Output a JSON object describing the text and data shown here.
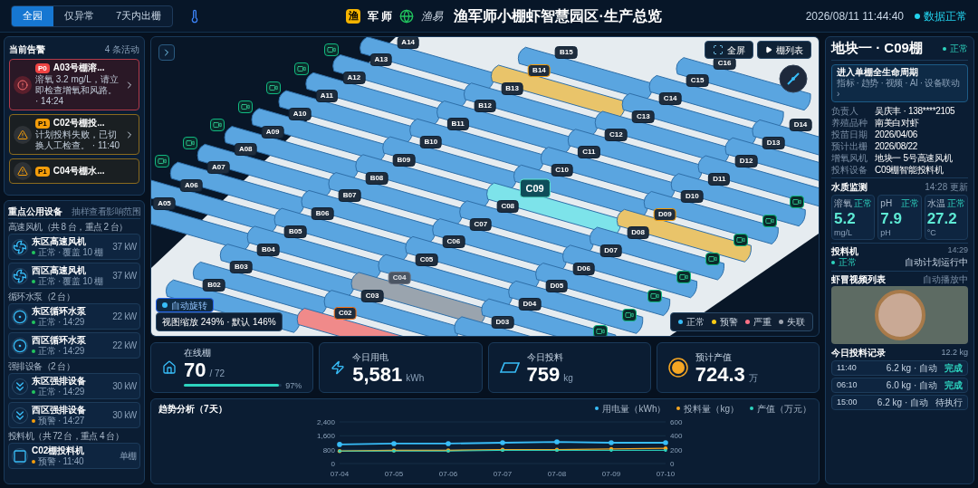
{
  "header": {
    "tabs": [
      {
        "label": "全园",
        "selected": true
      },
      {
        "label": "仅异常",
        "selected": false
      },
      {
        "label": "7天内出栅",
        "selected": false
      }
    ],
    "brand": {
      "mark": "渔",
      "name": "军 师",
      "partner": "渔易"
    },
    "title": "渔军师小棚虾智慧园区·生产总览",
    "datetime": "2026/08/11 11:44:40",
    "data_status": {
      "label": "数据正常",
      "ok": true
    }
  },
  "alerts": {
    "title": "当前告警",
    "count": "4 条活动",
    "items": [
      {
        "level": "P0",
        "kind": "critical",
        "title": "A03号棚溶...",
        "message": "溶氧 3.2 mg/L，请立即检查增氧和风路。 · 14:24"
      },
      {
        "level": "P1",
        "kind": "warning",
        "title": "C02号棚投...",
        "message": "计划投料失败，已切换人工检查。 · 11:40"
      },
      {
        "level": "P1",
        "kind": "warning",
        "title": "C04号棚水..."
      }
    ]
  },
  "equipment": {
    "title": "重点公用设备",
    "hint": "抽样查看影响范围",
    "groups": [
      {
        "label": "高速风机（共 8 台，重点 2 台）",
        "items": [
          {
            "kind": "fan",
            "name": "东区高速风机",
            "alert": false,
            "note": "正常 · 覆盖 10 棚",
            "value": "37 kW"
          },
          {
            "kind": "fan",
            "name": "西区高速风机",
            "alert": false,
            "note": "正常 · 覆盖 10 棚",
            "value": "37 kW"
          }
        ]
      },
      {
        "label": "循环水泵（2 台）",
        "items": [
          {
            "kind": "pump",
            "name": "东区循环水泵",
            "alert": false,
            "note": "正常 · 14:29",
            "value": "22 kW"
          },
          {
            "kind": "pump",
            "name": "西区循环水泵",
            "alert": false,
            "note": "正常 · 14:29",
            "value": "22 kW"
          }
        ]
      },
      {
        "label": "强排设备（2 台）",
        "items": [
          {
            "kind": "exhaust",
            "name": "东区强排设备",
            "alert": false,
            "note": "正常 · 14:29",
            "value": "30 kW"
          },
          {
            "kind": "exhaust",
            "name": "西区强排设备",
            "alert": true,
            "note": "预警 · 14:27",
            "value": "30 kW"
          }
        ]
      },
      {
        "label": "投料机（共 72 台，重点 4 台）",
        "items": [
          {
            "kind": "feeder",
            "name": "C02棚投料机",
            "alert": true,
            "note": "预警 · 11:40",
            "value": "单棚"
          }
        ]
      }
    ]
  },
  "map": {
    "buttons": [
      {
        "kind": "fullscreen",
        "label": "全屏"
      },
      {
        "kind": "list",
        "label": "棚列表"
      }
    ],
    "lanes": [
      {
        "houses": [
          {
            "label": "A14",
            "kind": "normal",
            "selected": false
          },
          {
            "label": "A13",
            "kind": "normal",
            "selected": false
          },
          {
            "label": "A12",
            "kind": "normal",
            "selected": false
          },
          {
            "label": "A11",
            "kind": "normal",
            "selected": false
          },
          {
            "label": "A10",
            "kind": "normal",
            "selected": false
          },
          {
            "label": "A09",
            "kind": "normal",
            "selected": false
          },
          {
            "label": "A08",
            "kind": "normal",
            "selected": false
          },
          {
            "label": "A07",
            "kind": "normal",
            "selected": false
          },
          {
            "label": "A06",
            "kind": "normal",
            "selected": false
          },
          {
            "label": "A05",
            "kind": "normal",
            "selected": false
          }
        ]
      },
      {
        "houses": [
          {
            "label": "B15",
            "kind": "normal",
            "selected": false
          },
          {
            "label": "B14",
            "kind": "warning",
            "selected": false
          },
          {
            "label": "B13",
            "kind": "normal",
            "selected": false
          },
          {
            "label": "B12",
            "kind": "normal",
            "selected": false
          },
          {
            "label": "B11",
            "kind": "normal",
            "selected": false
          },
          {
            "label": "B10",
            "kind": "normal",
            "selected": false
          },
          {
            "label": "B09",
            "kind": "normal",
            "selected": false
          },
          {
            "label": "B08",
            "kind": "normal",
            "selected": false
          },
          {
            "label": "B07",
            "kind": "normal",
            "selected": false
          },
          {
            "label": "B06",
            "kind": "normal",
            "selected": false
          },
          {
            "label": "B05",
            "kind": "normal",
            "selected": false
          },
          {
            "label": "B04",
            "kind": "normal",
            "selected": false
          },
          {
            "label": "B03",
            "kind": "normal",
            "selected": false
          },
          {
            "label": "B02",
            "kind": "normal",
            "selected": false
          }
        ]
      },
      {
        "houses": [
          {
            "label": "C16",
            "kind": "normal",
            "selected": false
          },
          {
            "label": "C15",
            "kind": "normal",
            "selected": false
          },
          {
            "label": "C14",
            "kind": "normal",
            "selected": false
          },
          {
            "label": "C13",
            "kind": "normal",
            "selected": false
          },
          {
            "label": "C12",
            "kind": "normal",
            "selected": false
          },
          {
            "label": "C11",
            "kind": "normal",
            "selected": false
          },
          {
            "label": "C10",
            "kind": "normal",
            "selected": false
          },
          {
            "label": "C09",
            "kind": "normal",
            "selected": true
          },
          {
            "label": "C08",
            "kind": "normal",
            "selected": false
          },
          {
            "label": "C07",
            "kind": "normal",
            "selected": false
          },
          {
            "label": "C06",
            "kind": "normal",
            "selected": false
          },
          {
            "label": "C05",
            "kind": "normal",
            "selected": false
          },
          {
            "label": "C04",
            "kind": "offline",
            "selected": false
          },
          {
            "label": "C03",
            "kind": "normal",
            "selected": false
          },
          {
            "label": "C02",
            "kind": "severe",
            "selected": false
          }
        ]
      },
      {
        "houses": [
          {
            "label": "D14",
            "kind": "normal",
            "selected": false
          },
          {
            "label": "D13",
            "kind": "normal",
            "selected": false
          },
          {
            "label": "D12",
            "kind": "normal",
            "selected": false
          },
          {
            "label": "D11",
            "kind": "normal",
            "selected": false
          },
          {
            "label": "D10",
            "kind": "normal",
            "selected": false
          },
          {
            "label": "D09",
            "kind": "warning",
            "selected": false
          },
          {
            "label": "D08",
            "kind": "normal",
            "selected": false
          },
          {
            "label": "D07",
            "kind": "normal",
            "selected": false
          },
          {
            "label": "D06",
            "kind": "normal",
            "selected": false
          },
          {
            "label": "D05",
            "kind": "normal",
            "selected": false
          },
          {
            "label": "D04",
            "kind": "normal",
            "selected": false
          },
          {
            "label": "D03",
            "kind": "normal",
            "selected": false
          }
        ]
      }
    ],
    "auto_rotate": {
      "label": "自动旋转",
      "on": true
    },
    "zoom_text": "视图缩放 249% · 默认 146%",
    "legend": [
      {
        "label": "正常",
        "color": "#38bdf8"
      },
      {
        "label": "预警",
        "color": "#facc15"
      },
      {
        "label": "严重",
        "color": "#fb7185"
      },
      {
        "label": "失联",
        "color": "#9ca3af"
      }
    ]
  },
  "stats": [
    {
      "kind": "greenhouses",
      "label": "在线棚",
      "value": "70",
      "unit": "/ 72",
      "level": 0.97,
      "percent": "97%"
    },
    {
      "kind": "power",
      "label": "今日用电",
      "value": "5,581",
      "unit": "kWh"
    },
    {
      "kind": "feed",
      "label": "今日投料",
      "value": "759",
      "unit": "kg"
    },
    {
      "kind": "yield",
      "label": "预计产值",
      "value": "724.3",
      "unit": "万"
    }
  ],
  "trend": {
    "title": "趋势分析（7天）",
    "chart_data": {
      "type": "line",
      "categories": [
        "07-04",
        "07-05",
        "07-06",
        "07-07",
        "07-08",
        "07-09",
        "07-10"
      ],
      "ylim": [
        0,
        2400
      ],
      "yticks": [
        0,
        {
          "value": 800,
          "label": "800"
        },
        {
          "value": 1600,
          "label": "1,600"
        },
        {
          "value": 2400,
          "label": "2,400"
        }
      ],
      "y2lim": [
        0,
        600
      ],
      "y2ticks": [
        0,
        200,
        400,
        600
      ],
      "series": [
        {
          "name": "用电量（kWh）",
          "color": "#38bdf8",
          "values": [
            1100,
            1150,
            1150,
            1200,
            1250,
            1200,
            1200
          ]
        },
        {
          "name": "投料量（kg）",
          "color": "#f5a623",
          "axis": "y2",
          "values": [
            180,
            190,
            190,
            200,
            200,
            210,
            220
          ]
        },
        {
          "name": "产值（万元）",
          "color": "#2dd4bf",
          "axis": "y2",
          "values": [
            180,
            180,
            180,
            190,
            190,
            190,
            190
          ]
        }
      ]
    }
  },
  "detail": {
    "title": "地块一 · C09棚",
    "status": {
      "label": "正常",
      "ok": true
    },
    "lifecycle": {
      "title": "进入单棚全生命周期",
      "subtitle": "指标 · 趋势 · 视频 · AI · 设备联动 ›"
    },
    "info": [
      {
        "label": "负责人",
        "value": "吴庆丰 · 138****2105"
      },
      {
        "label": "养殖品种",
        "value": "南美白对虾"
      },
      {
        "label": "投苗日期",
        "value": "2026/04/06"
      },
      {
        "label": "预计出栅",
        "value": "2026/08/22"
      },
      {
        "label": "增氧风机",
        "value": "地块一 5号高速风机"
      },
      {
        "label": "投料设备",
        "value": "C09棚智能投料机"
      }
    ],
    "water": {
      "title": "水质监测",
      "updated": "14:28 更新",
      "metrics": [
        {
          "label": "溶氧",
          "status": "正常",
          "value": "5.2",
          "unit": "mg/L"
        },
        {
          "label": "pH",
          "status": "正常",
          "value": "7.9",
          "unit": "pH"
        },
        {
          "label": "水温",
          "status": "正常",
          "value": "27.2",
          "unit": "°C"
        }
      ]
    },
    "feeder": {
      "title": "投料机",
      "time": "14:29",
      "status": {
        "label": "正常",
        "ok": true
      },
      "note": "自动计划运行中"
    },
    "video": {
      "title": "虾冒视频列表",
      "note": "自动播放中"
    },
    "records": {
      "title": "今日投料记录",
      "total": "12.2 kg",
      "rows": [
        {
          "time": "11:40",
          "amount": "6.2 kg · 自动",
          "state": "完成",
          "done": true
        },
        {
          "time": "06:10",
          "amount": "6.0 kg · 自动",
          "state": "完成",
          "done": true
        },
        {
          "time": "15:00",
          "amount": "6.2 kg · 自动",
          "state": "待执行",
          "done": false
        }
      ]
    }
  }
}
